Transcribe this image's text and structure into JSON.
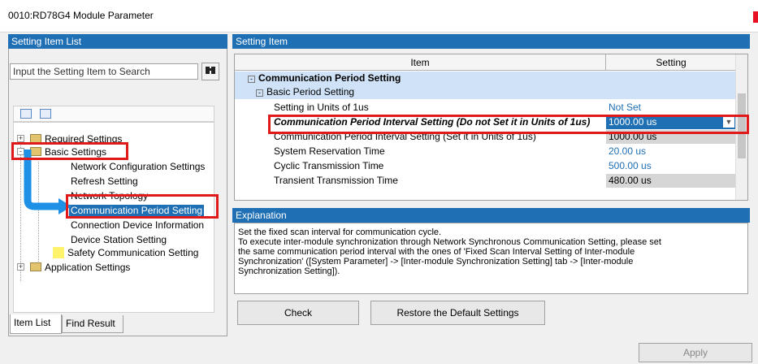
{
  "window": {
    "title": "0010:RD78G4 Module Parameter"
  },
  "left_panel": {
    "header": "Setting Item List",
    "search_placeholder": "Input the Setting Item to Search",
    "tree": [
      {
        "label": "Required Settings"
      },
      {
        "label": "Basic Settings"
      },
      {
        "label": "Network Configuration Settings"
      },
      {
        "label": "Refresh Setting"
      },
      {
        "label": "Network Topology"
      },
      {
        "label": "Communication Period Setting"
      },
      {
        "label": "Connection Device Information"
      },
      {
        "label": "Device Station Setting"
      },
      {
        "label": "Safety Communication Setting"
      },
      {
        "label": "Application Settings"
      }
    ],
    "tabs": [
      "Item List",
      "Find Result"
    ]
  },
  "right_panel": {
    "header": "Setting Item",
    "columns": [
      "Item",
      "Setting"
    ],
    "rows": [
      {
        "item": "Communication Period Setting",
        "setting": ""
      },
      {
        "item": "Basic Period Setting",
        "setting": ""
      },
      {
        "item": "Setting in Units of 1us",
        "setting": "Not Set"
      },
      {
        "item": "Communication Period Interval Setting (Do not Set it in Units of 1us)",
        "setting": "1000.00 us"
      },
      {
        "item": "Communication Period Interval Setting (Set it in Units of 1us)",
        "setting": "1000.00 us"
      },
      {
        "item": "System Reservation Time",
        "setting": "20.00 us"
      },
      {
        "item": "Cyclic Transmission Time",
        "setting": "500.00 us"
      },
      {
        "item": "Transient Transmission Time",
        "setting": "480.00 us"
      }
    ],
    "explanation_header": "Explanation",
    "explanation_lines": [
      "Set the fixed scan interval for communication cycle.",
      "To execute inter-module synchronization through Network Synchronous Communication Setting, please set",
      "the same communication period interval with the ones of 'Fixed Scan Interval Setting of Inter-module",
      "Synchronization' ([System Parameter] -> [Inter-module Synchronization Setting] tab -> [Inter-module",
      "Synchronization Setting])."
    ],
    "check_label": "Check",
    "restore_label": "Restore the Default Settings"
  },
  "footer": {
    "apply_label": "Apply"
  },
  "colors": {
    "header_blue": "#1f6fb5",
    "highlight_red": "#e01a1a",
    "group_blue": "#cfe2f7"
  }
}
